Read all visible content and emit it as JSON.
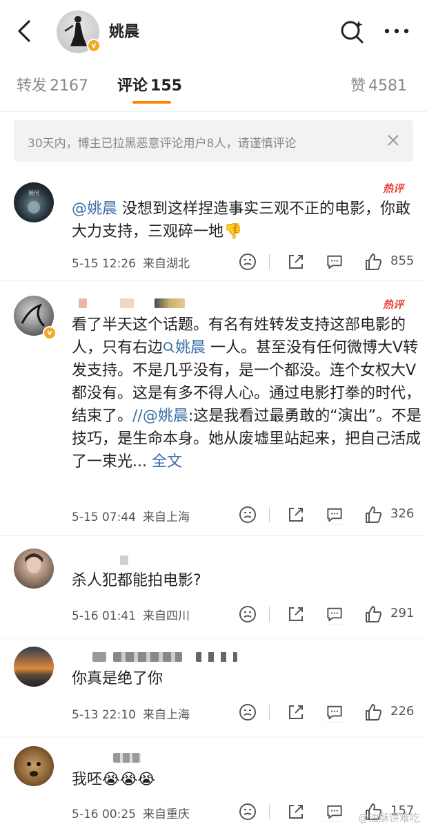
{
  "header": {
    "username": "姚晨",
    "verified_badge": "v",
    "icons": [
      "back-arrow-icon",
      "search-icon",
      "more-icon"
    ]
  },
  "tabs": [
    {
      "label": "转发",
      "count": "2167",
      "active": false
    },
    {
      "label": "评论",
      "count": "155",
      "active": true
    },
    {
      "label": "赞",
      "count": "4581",
      "active": false
    }
  ],
  "notice": {
    "text": "30天内，博主已拉黑恶意评论用户8人，请谨慎评论"
  },
  "hot_label": "热评",
  "comments": [
    {
      "mention": "@姚晨",
      "text": " 没想到这样捏造事实三观不正的电影，你敢大力支持，三观碎一地👎",
      "date": "5-15 12:26",
      "location": "来自湖北",
      "likes": "855"
    },
    {
      "line1": "看了半天这个话题。有名有姓转发支持这部电影的人，只有右边",
      "search_link": "姚晨",
      "line2": " 一人。甚至没有任何微博大V转发支持。不是几乎没有，是一个都没。连个女权大V都没有。这是有多不得人心。通过电影打拳的时代，结束了。",
      "repost_mention": "//@姚晨",
      "repost_text": ":这是我看过最勇敢的“演出”。不是技巧，是生命本身。她从废墟里站起来，把自己活成了一束光...",
      "full_text": " 全文",
      "date": "5-15 07:44",
      "location": "来自上海",
      "likes": "326"
    },
    {
      "text": "杀人犯都能拍电影?",
      "date": "5-16 01:41",
      "location": "来自四川",
      "likes": "291"
    },
    {
      "text": "你真是绝了你",
      "date": "5-13 22:10",
      "location": "来自上海",
      "likes": "226"
    },
    {
      "text": "我呸😭😭😭",
      "date": "5-16 00:25",
      "location": "来自重庆",
      "likes": "157"
    }
  ],
  "watermark": "@油酥饼难吃",
  "colors": {
    "accent": "#ff8200",
    "link": "#3a6ea5",
    "hot": "#e8443a"
  }
}
